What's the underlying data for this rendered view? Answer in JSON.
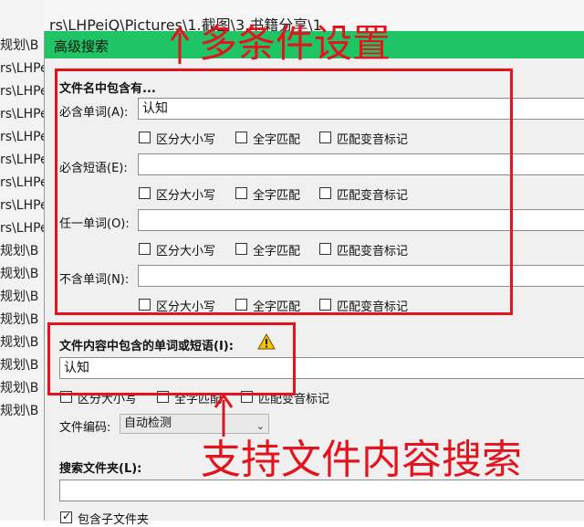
{
  "background": {
    "path_text": "rs\\LHPeiQ\\Pictures\\1.截图\\3.书籍分享\\1",
    "rows": [
      "规划\\B",
      "rs\\LHPe",
      "rs\\LHPe",
      "rs\\LHPe",
      "rs\\LHPe",
      "rs\\LHPe",
      "rs\\LHPe",
      "rs\\LHPe",
      "rs\\LHPe",
      "规划\\B",
      "规划\\B",
      "规划\\B",
      "规划\\B",
      "规划\\B",
      "规划\\B",
      "规划\\B",
      "规划\\B"
    ]
  },
  "dialog": {
    "title": "高级搜索",
    "filename_section": {
      "title": "文件名中包含有...",
      "rows": [
        {
          "label": "必含单词(A):",
          "value": "认知"
        },
        {
          "label": "必含短语(E):",
          "value": ""
        },
        {
          "label": "任一单词(O):",
          "value": ""
        },
        {
          "label": "不含单词(N):",
          "value": ""
        }
      ],
      "options": [
        "区分大小写",
        "全字匹配",
        "匹配变音标记"
      ]
    },
    "content_section": {
      "title": "文件内容中包含的单词或短语(I):",
      "value": "认知",
      "options": [
        "区分大小写",
        "全字匹配",
        "匹配变音标记"
      ]
    },
    "encoding": {
      "label": "文件编码:",
      "value": "自动检测"
    },
    "folder_section": {
      "title": "搜索文件夹(L):",
      "value": "",
      "subfolder_label": "包含子文件夹"
    }
  },
  "annotations": {
    "top": "多条件设置",
    "bottom": "支持文件内容搜索",
    "color": "#e3141e"
  }
}
